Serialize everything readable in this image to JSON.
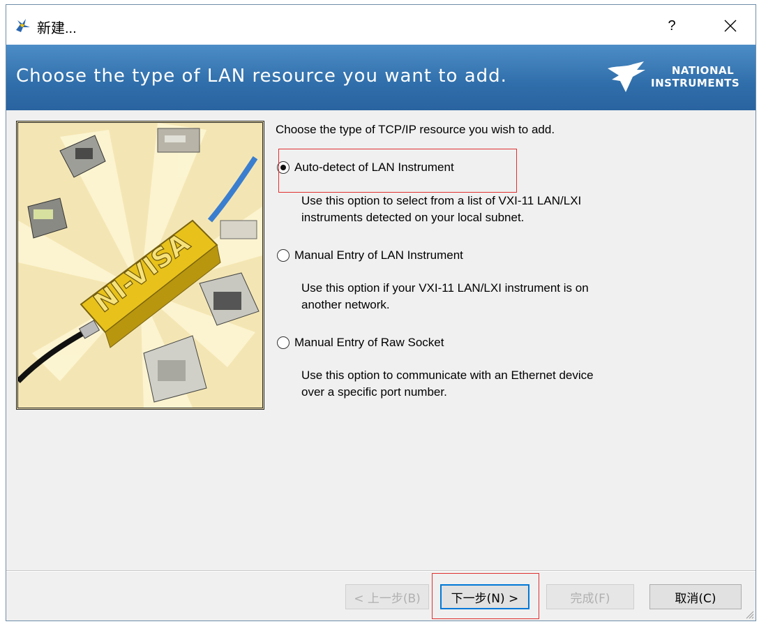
{
  "window": {
    "title": "新建...",
    "help_label": "?",
    "close_label": "✕"
  },
  "header": {
    "text": "Choose the type of LAN resource you want to add.",
    "logo_line1": "NATIONAL",
    "logo_line2": "INSTRUMENTS"
  },
  "illustration": {
    "logo_text": "NI-VISA"
  },
  "content": {
    "instruction": "Choose the type of TCP/IP resource you wish to add.",
    "options": [
      {
        "label": "Auto-detect of LAN Instrument",
        "selected": true,
        "desc_line1": "Use this option to select from a list of VXI-11 LAN/LXI",
        "desc_line2": "instruments detected on your local subnet."
      },
      {
        "label": "Manual Entry of LAN Instrument",
        "selected": false,
        "desc_line1": "Use this option if your VXI-11 LAN/LXI instrument is on",
        "desc_line2": "another network."
      },
      {
        "label": "Manual Entry of Raw Socket",
        "selected": false,
        "desc_line1": "Use this option to communicate with an Ethernet device",
        "desc_line2": "over a specific port number."
      }
    ]
  },
  "buttons": {
    "back": "< 上一步(B)",
    "next": "下一步(N) >",
    "finish": "完成(F)",
    "cancel": "取消(C)"
  },
  "colors": {
    "header": "#2f6eaa",
    "highlight": "#e03030",
    "illustration_bg": "#f4e6b4",
    "visa_yellow": "#e8c21a"
  }
}
